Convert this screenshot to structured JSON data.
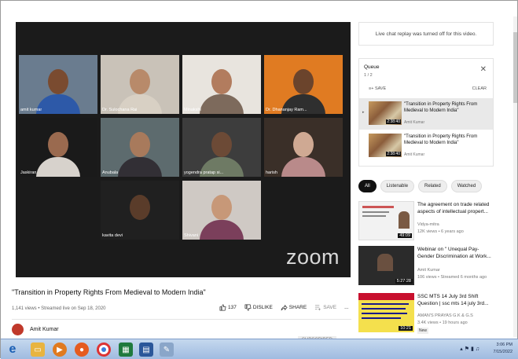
{
  "chat": {
    "replay_message": "Live chat replay was turned off for this video."
  },
  "participants": [
    {
      "name": "amit kumar",
      "bg": "#6a7c8f",
      "skin": "#7a4b30",
      "shirt": "#2d59a8",
      "active": true
    },
    {
      "name": "Dr. Sulochana Rai",
      "bg": "#c9c2b8",
      "skin": "#b88a6a",
      "shirt": "#d8d0c4",
      "active": false
    },
    {
      "name": "Minakshi",
      "bg": "#e8e4de",
      "skin": "#b27c5e",
      "shirt": "#7d6a5c",
      "active": false
    },
    {
      "name": "Dr. Dhananjay Ram...",
      "bg": "#e07b22",
      "skin": "#6b442c",
      "shirt": "#2f2f2f",
      "active": false
    },
    {
      "name": "Jaskiran",
      "bg": "#1a1a1a",
      "skin": "#9a6a4f",
      "shirt": "#d7d2cc",
      "active": false
    },
    {
      "name": "Anubala",
      "bg": "#5d6b6e",
      "skin": "#a87a5c",
      "shirt": "#322f35",
      "active": false
    },
    {
      "name": "yogendra pratap si...",
      "bg": "#3d3d3d",
      "skin": "#6c4a36",
      "shirt": "#6e7a64",
      "active": false
    },
    {
      "name": "harish",
      "bg": "#3a2f28",
      "skin": "#cfa993",
      "shirt": "#b98a8a",
      "active": false
    },
    {
      "name": "kavita devi",
      "bg": "#202020",
      "skin": "#5a3c2a",
      "shirt": "#202020",
      "active": false
    },
    {
      "name": "Shivani",
      "bg": "#cfc9c4",
      "skin": "#c79878",
      "shirt": "#7b3f5b",
      "active": false
    }
  ],
  "video": {
    "watermark": "zoom",
    "title": "\"Transition in Property Rights From Medieval to Modern India\"",
    "meta": "1,141 views • Streamed live on Sep 18, 2020"
  },
  "actions": {
    "like_count": "137",
    "dislike_label": "DISLIKE",
    "share_label": "SHARE",
    "save_label": "SAVE",
    "more_label": "..."
  },
  "channel": {
    "name": "Amit Kumar",
    "subscribe_label": "SUBSCRIBED"
  },
  "queue": {
    "title": "Queue",
    "count": "1 / 2",
    "save_label": "SAVE",
    "clear_label": "CLEAR",
    "items": [
      {
        "title": "\"Transition in Property Rights From Medieval to Modern India\"",
        "channel": "Amit Kumar",
        "duration": "2:38:40"
      },
      {
        "title": "\"Transition in Property Rights From Medieval to Modern India\"",
        "channel": "Amit Kumar",
        "duration": "2:38:40"
      }
    ]
  },
  "chips": [
    "All",
    "Listenable",
    "Related",
    "Watched"
  ],
  "recommendations": [
    {
      "title": "The agreement on trade related aspects of intellectual propert...",
      "channel": "Vidya-mitra",
      "meta": "12K views • 6 years ago",
      "duration": "49:09",
      "thumb_color": "#f2f2f2",
      "badge": ""
    },
    {
      "title": "Webinar on \" Unequal Pay- Gender Discrimination at Work...",
      "channel": "Amit Kumar",
      "meta": "106 views • Streamed 6 months ago",
      "duration": "5:27:28",
      "thumb_color": "#2b2b2b",
      "badge": ""
    },
    {
      "title": "SSC MTS 14 July 3rd Shift Question | ssc mts 14 july 3rd...",
      "channel": "AMAN'S PRAYAS G.K & G.S",
      "meta": "3.4K views • 19 hours ago",
      "duration": "10:21",
      "thumb_color": "#f4e04d",
      "badge": "New"
    }
  ],
  "taskbar": {
    "time": "3:06 PM",
    "date": "7/15/2022"
  },
  "icons": [
    "ie-icon",
    "folder-icon",
    "media-player-icon",
    "firefox-icon",
    "chrome-icon",
    "excel-icon",
    "word-icon",
    "paint-icon"
  ]
}
